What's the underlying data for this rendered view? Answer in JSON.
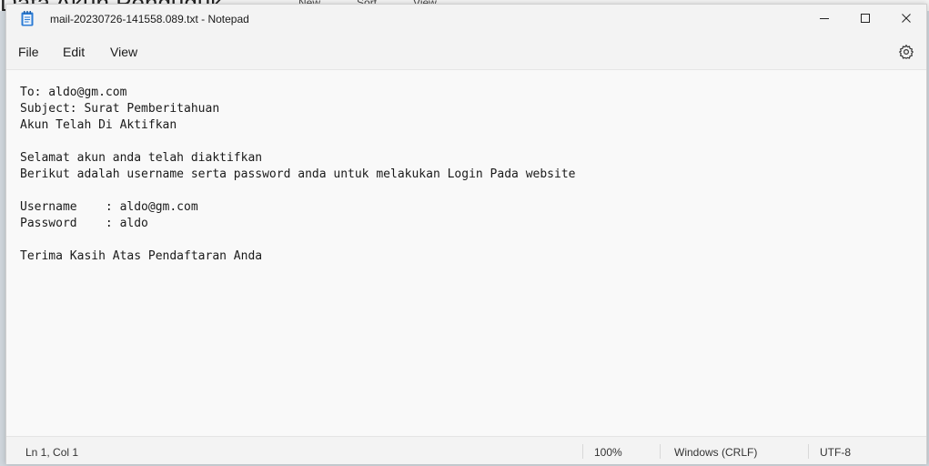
{
  "background_window": {
    "title": "Data Akun Penduduk",
    "tools": [
      "New",
      "Sort",
      "View",
      "..."
    ]
  },
  "window": {
    "title": "mail-20230726-141558.089.txt - Notepad",
    "controls": {
      "minimize": "minimize-icon",
      "maximize": "maximize-icon",
      "close": "close-icon"
    }
  },
  "menu": {
    "file": "File",
    "edit": "Edit",
    "view": "View",
    "settings_icon": "gear-icon"
  },
  "editor": {
    "content": "To: aldo@gm.com\nSubject: Surat Pemberitahuan\nAkun Telah Di Aktifkan\n\nSelamat akun anda telah diaktifkan\nBerikut adalah username serta password anda untuk melakukan Login Pada website\n\nUsername    : aldo@gm.com\nPassword    : aldo\n\nTerima Kasih Atas Pendaftaran Anda"
  },
  "status": {
    "position": "Ln 1, Col 1",
    "zoom": "100%",
    "line_ending": "Windows (CRLF)",
    "encoding": "UTF-8"
  },
  "colors": {
    "app_icon": "#2b7bd4",
    "background": "#f9f9f9",
    "chrome": "#f3f3f3"
  }
}
